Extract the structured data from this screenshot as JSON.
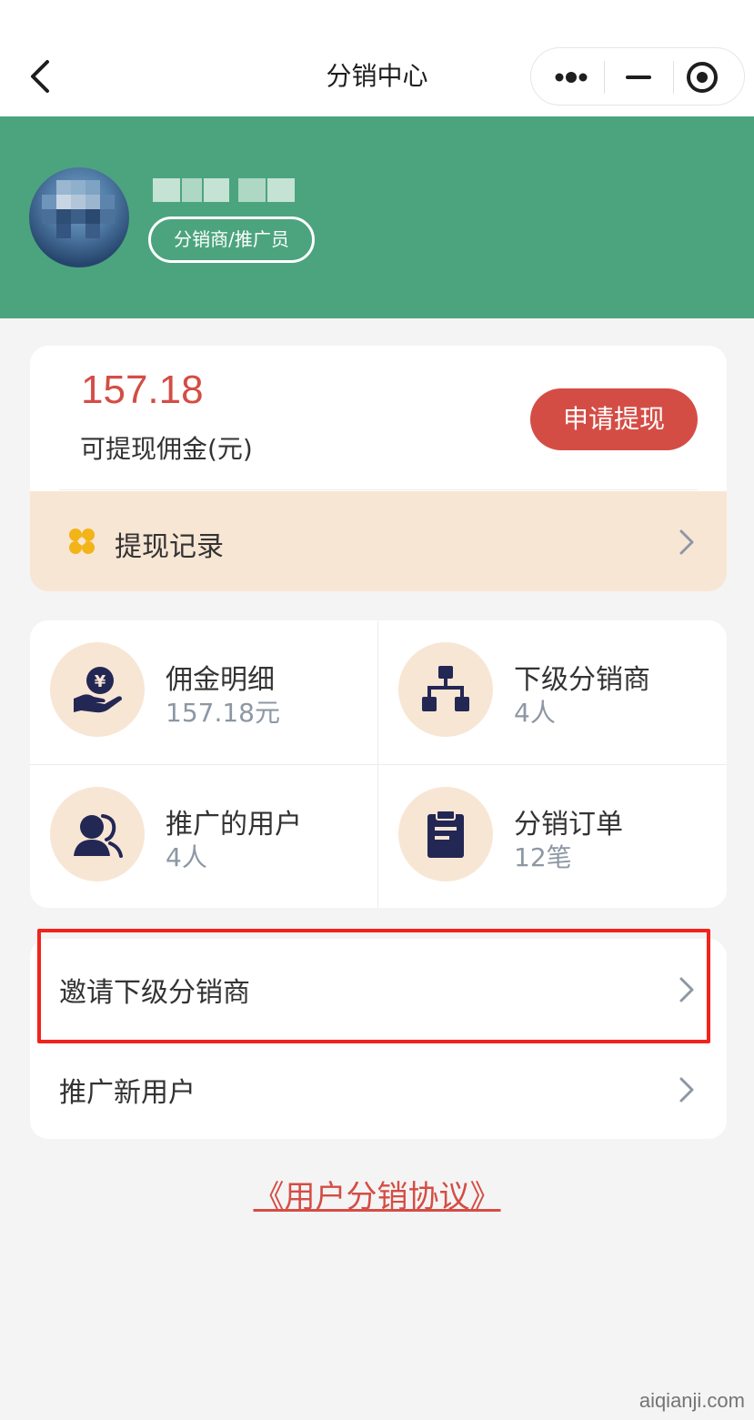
{
  "nav": {
    "title": "分销中心"
  },
  "profile": {
    "role": "分销商/推广员"
  },
  "balance": {
    "amount": "157.18",
    "label": "可提现佣金(元)",
    "withdraw_button": "申请提现",
    "record_label": "提现记录"
  },
  "stats": [
    {
      "title": "佣金明细",
      "value": "157.18元",
      "icon": "coin-hand-icon"
    },
    {
      "title": "下级分销商",
      "value": "4人",
      "icon": "hierarchy-icon"
    },
    {
      "title": "推广的用户",
      "value": "4人",
      "icon": "users-icon"
    },
    {
      "title": "分销订单",
      "value": "12笔",
      "icon": "clipboard-icon"
    }
  ],
  "menu": [
    {
      "label": "邀请下级分销商"
    },
    {
      "label": "推广新用户"
    }
  ],
  "agreement": "《用户分销协议》",
  "watermark": "aiqianji.com",
  "colors": {
    "brand_green": "#4ca47e",
    "accent_red": "#d44d45",
    "icon_bg": "#f8e6d5",
    "icon_fg": "#232754",
    "highlight": "#f2231b"
  }
}
